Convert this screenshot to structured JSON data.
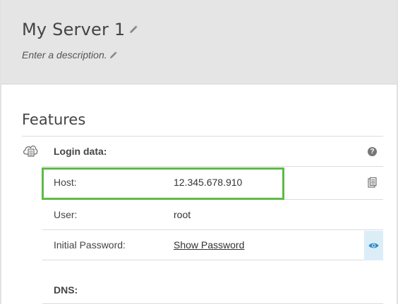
{
  "header": {
    "server_name": "My Server 1",
    "description_placeholder": "Enter a description."
  },
  "features": {
    "title": "Features",
    "login_data_label": "Login data:",
    "rows": {
      "host": {
        "label": "Host:",
        "value": "12.345.678.910"
      },
      "user": {
        "label": "User:",
        "value": "root"
      },
      "password": {
        "label": "Initial Password:",
        "value": "Show Password"
      }
    },
    "dns_label": "DNS:"
  },
  "icons": {
    "edit": "pencil-icon",
    "login": "cloud-server-icon",
    "help": "question-circle-icon",
    "copy": "clipboard-icon",
    "reveal": "eye-icon"
  },
  "colors": {
    "highlight": "#5dbb46",
    "link": "#2d8ac7",
    "header_bg": "#e5e5e5",
    "eye_bg": "#dbeef8"
  }
}
